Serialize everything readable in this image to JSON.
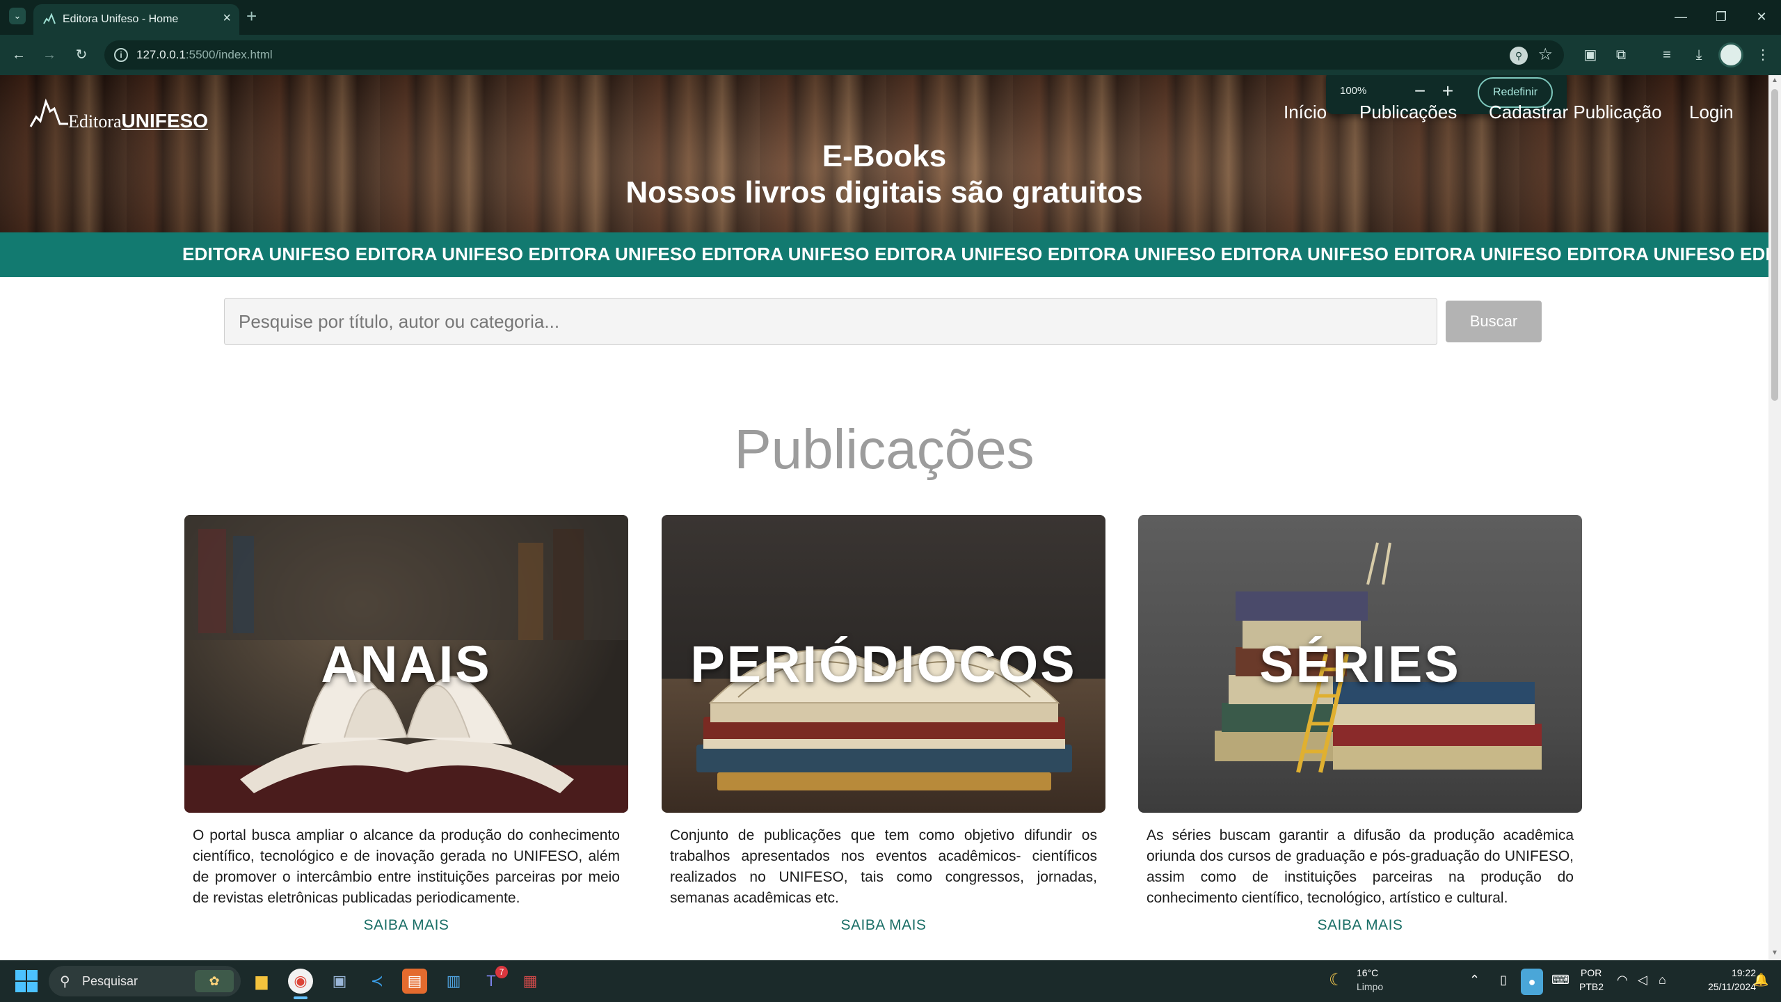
{
  "browser": {
    "tab_title": "Editora Unifeso - Home",
    "url_host": "127.0.0.1",
    "url_path": ":5500/index.html",
    "zoom_popup": {
      "level": "100%",
      "reset_label": "Redefinir"
    }
  },
  "site": {
    "logo_prefix": "Editora",
    "logo_bold": "UNIFESO",
    "nav": [
      "Início",
      "Publicações",
      "Cadastrar Publicação",
      "Login"
    ],
    "hero_title": "E-Books",
    "hero_subtitle": "Nossos livros digitais são gratuitos",
    "marquee": "EDITORA UNIFESO EDITORA UNIFESO EDITORA UNIFESO EDITORA UNIFESO EDITORA UNIFESO EDITORA UNIFESO EDITORA UNIFESO EDITORA UNIFESO EDITORA UNIFESO EDITORA UNIFESO EDITO",
    "search": {
      "placeholder": "Pesquise por título, autor ou categoria...",
      "button": "Buscar"
    },
    "section_title": "Publicações",
    "cards": [
      {
        "label": "ANAIS",
        "text": "O portal busca ampliar o alcance da produção do conhecimento científico, tecnológico e de inovação gerada no UNIFESO, além de promover o intercâmbio entre instituições parceiras por meio de revistas eletrônicas publicadas periodicamente.",
        "link": "SAIBA MAIS"
      },
      {
        "label": "PERIÓDIOCOS",
        "text": "Conjunto de publicações que tem como objetivo difundir os trabalhos apresentados nos eventos acadêmicos- científicos realizados no UNIFESO, tais como congressos, jornadas, semanas acadêmicas etc.",
        "link": "SAIBA MAIS"
      },
      {
        "label": "SÉRIES",
        "text": "As séries buscam garantir a difusão da produção acadêmica oriunda dos cursos de graduação e pós-graduação do UNIFESO, assim como de instituições parceiras na produção do conhecimento científico, tecnológico, artístico e cultural.",
        "link": "SAIBA MAIS"
      }
    ]
  },
  "taskbar": {
    "search_label": "Pesquisar",
    "teams_badge": "7",
    "weather_temp": "16°C",
    "weather_desc": "Limpo",
    "lang_line1": "POR",
    "lang_line2": "PTB2",
    "time": "19:22",
    "date": "25/11/2024"
  }
}
